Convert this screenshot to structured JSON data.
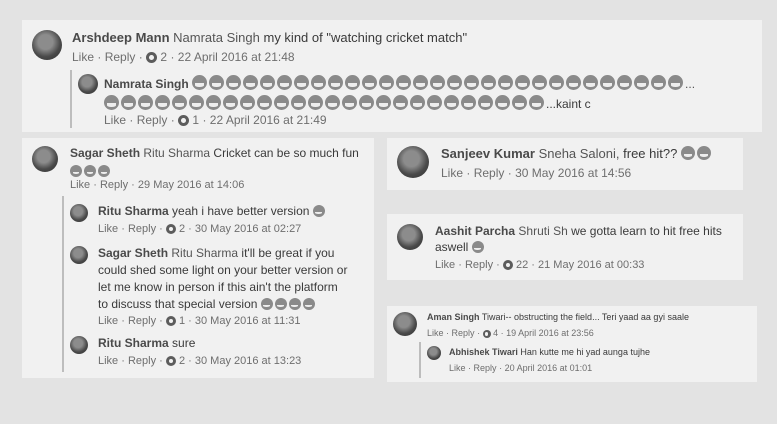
{
  "actions": {
    "like": "Like",
    "reply": "Reply",
    "sep": "·"
  },
  "thread1": {
    "comment": {
      "author": "Arshdeep Mann",
      "tag": "Namrata Singh",
      "text": "my kind of \"watching cricket match\"",
      "replies_count": "2",
      "timestamp": "22 April 2016 at 21:48"
    },
    "reply": {
      "author": "Namrata Singh",
      "ellipsis": "...",
      "text_end": "...kaint c",
      "replies_count": "1",
      "timestamp": "22 April 2016 at 21:49"
    }
  },
  "thread2": {
    "comment": {
      "author": "Sagar Sheth",
      "tag": "Ritu Sharma",
      "text": "Cricket can be so much fun",
      "timestamp": "29 May 2016 at 14:06"
    },
    "replies": [
      {
        "author": "Ritu Sharma",
        "text": "yeah i have better version",
        "replies_count": "2",
        "timestamp": "30 May 2016 at 02:27"
      },
      {
        "author": "Sagar Sheth",
        "tag": "Ritu Sharma",
        "line1": "it'll be great if you",
        "line2": "could shed some light on your better version or",
        "line3": "let me know in person if this ain't the platform",
        "line4": "to discuss that special version",
        "replies_count": "1",
        "timestamp": "30 May 2016 at 11:31"
      },
      {
        "author": "Ritu Sharma",
        "text": "sure",
        "replies_count": "2",
        "timestamp": "30 May 2016 at 13:23"
      }
    ]
  },
  "thread3": {
    "author": "Sanjeev Kumar",
    "tag": "Sneha Saloni,",
    "text": "free hit??",
    "timestamp": "30 May 2016 at 14:56"
  },
  "thread4": {
    "author": "Aashit Parcha",
    "tag": "Shruti Sh",
    "line1": "we gotta learn to hit free hits",
    "line2": "aswell",
    "replies_count": "22",
    "timestamp": "21 May 2016 at 00:33"
  },
  "thread5": {
    "comment": {
      "author": "Aman Singh",
      "text": "Tiwari-- obstructing the field... Teri yaad aa gyi saale",
      "replies_count": "4",
      "timestamp": "19 April 2016 at 23:56"
    },
    "reply": {
      "author": "Abhishek Tiwari",
      "text": "Han kutte me hi yad aunga tujhe",
      "timestamp": "20 April 2016 at 01:01"
    }
  }
}
